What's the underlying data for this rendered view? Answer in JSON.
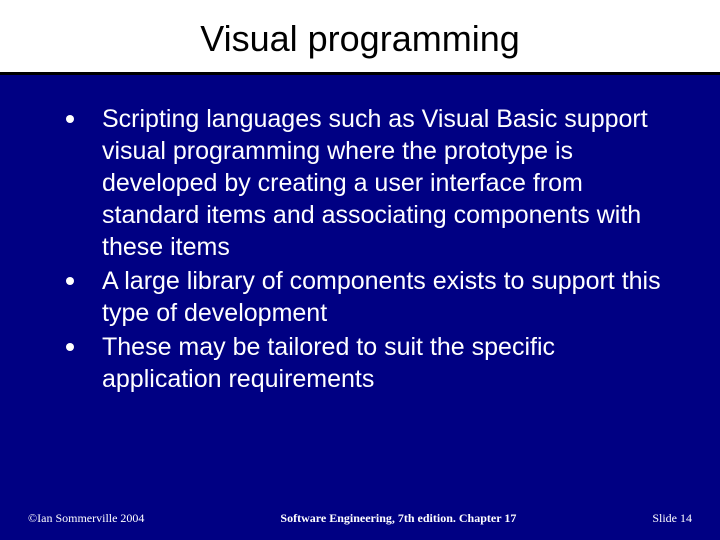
{
  "title": "Visual programming",
  "bullets": [
    "Scripting languages such as Visual Basic support visual programming where the prototype is developed by creating a user interface from standard items and associating components with these items",
    "A large library of components exists to support this type of development",
    "These may be tailored to suit the specific application requirements"
  ],
  "footer": {
    "left": "©Ian Sommerville 2004",
    "center": "Software Engineering, 7th edition. Chapter 17",
    "right": "Slide 14"
  }
}
